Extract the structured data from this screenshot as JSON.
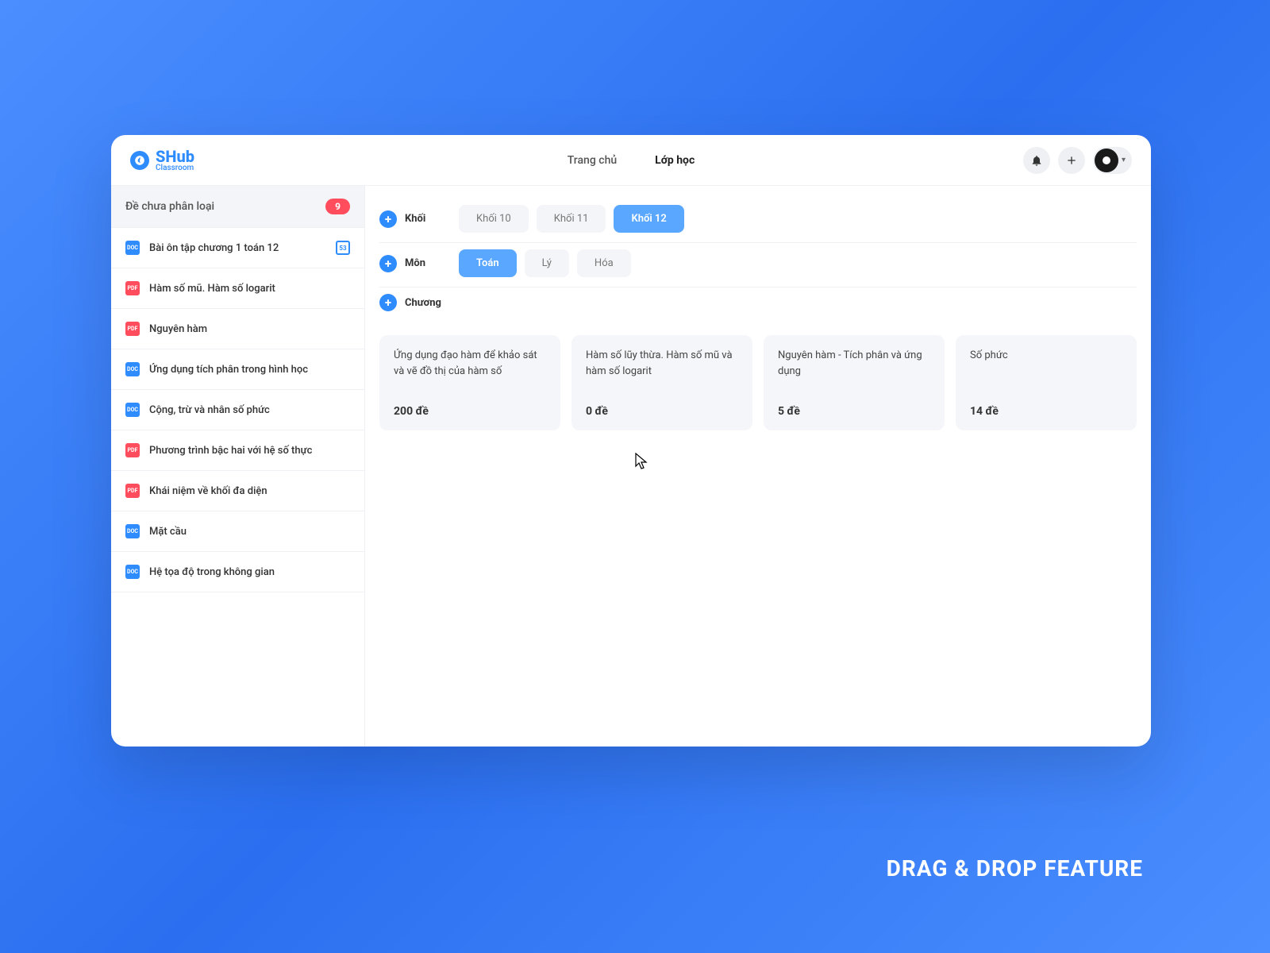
{
  "caption": "DRAG & DROP FEATURE",
  "brand": {
    "name": "SHub",
    "tagline": "Classroom"
  },
  "topnav": {
    "items": [
      {
        "label": "Trang chủ",
        "active": false
      },
      {
        "label": "Lớp học",
        "active": true
      }
    ]
  },
  "sidebar": {
    "header_label": "Đề chưa phân loại",
    "header_badge": "9",
    "items": [
      {
        "type": "doc",
        "label": "Bài ôn tập chương 1 toán 12",
        "trailing": true
      },
      {
        "type": "pdf",
        "label": "Hàm số mũ. Hàm số logarit"
      },
      {
        "type": "pdf",
        "label": "Nguyên hàm"
      },
      {
        "type": "doc",
        "label": "Ứng dụng tích phân trong hình học"
      },
      {
        "type": "doc",
        "label": "Cộng, trừ và nhân số phức"
      },
      {
        "type": "pdf",
        "label": "Phương trình bậc hai với hệ số thực"
      },
      {
        "type": "pdf",
        "label": "Khái niệm về khối đa diện"
      },
      {
        "type": "doc",
        "label": "Mặt cầu"
      },
      {
        "type": "doc",
        "label": "Hệ tọa độ trong không gian"
      }
    ]
  },
  "filters": {
    "khoi": {
      "label": "Khối",
      "options": [
        {
          "label": "Khối 10",
          "active": false
        },
        {
          "label": "Khối 11",
          "active": false
        },
        {
          "label": "Khối 12",
          "active": true
        }
      ]
    },
    "mon": {
      "label": "Môn",
      "options": [
        {
          "label": "Toán",
          "active": true
        },
        {
          "label": "Lý",
          "active": false
        },
        {
          "label": "Hóa",
          "active": false
        }
      ]
    },
    "chuong": {
      "label": "Chương"
    }
  },
  "cards": [
    {
      "title": "Ứng dụng đạo hàm để khảo sát và vẽ đồ thị của hàm số",
      "count": "200 đề"
    },
    {
      "title": "Hàm số lũy thừa. Hàm số mũ và hàm số logarit",
      "count": "0 đề"
    },
    {
      "title": "Nguyên hàm - Tích phân và ứng dụng",
      "count": "5 đề"
    },
    {
      "title": "Số phức",
      "count": "14 đề"
    }
  ],
  "file_labels": {
    "doc": "DOC",
    "pdf": "PDF"
  }
}
